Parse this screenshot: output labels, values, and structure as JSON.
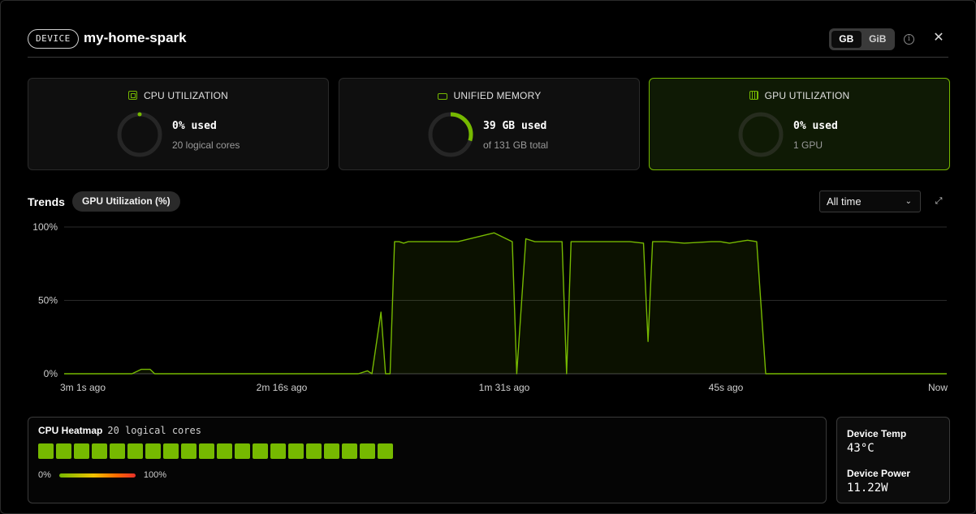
{
  "header": {
    "badge": "DEVICE",
    "device_name": "my-home-spark",
    "unit_options": [
      "GB",
      "GiB"
    ],
    "unit_selected": "GB"
  },
  "cards": {
    "cpu": {
      "title": "CPU UTILIZATION",
      "main": "0% used",
      "sub": "20 logical cores",
      "fraction": 0.0
    },
    "memory": {
      "title": "UNIFIED MEMORY",
      "main": "39  GB used",
      "sub": "of 131 GB total",
      "fraction": 0.298
    },
    "gpu": {
      "title": "GPU UTILIZATION",
      "main": "0% used",
      "sub": "1 GPU",
      "fraction": 0.0
    }
  },
  "trends": {
    "label": "Trends",
    "metric_pill": "GPU Utilization (%)",
    "range": "All time"
  },
  "chart_data": {
    "type": "area",
    "y_ticks": [
      "0%",
      "50%",
      "100%"
    ],
    "ylim": [
      0,
      100
    ],
    "x_ticks": [
      "3m 1s ago",
      "2m 16s ago",
      "1m 31s ago",
      "45s ago",
      "Now"
    ],
    "xlim_seconds_ago": [
      195,
      0
    ],
    "grid": true,
    "color": "#76b900",
    "series": [
      {
        "x_seconds_ago": [
          195,
          180,
          178,
          176,
          175,
          130,
          128,
          127,
          125,
          124,
          123,
          122,
          121,
          120,
          119,
          118,
          117,
          115,
          112,
          108,
          100,
          96,
          95,
          93,
          91,
          89,
          86,
          85,
          84,
          83,
          81,
          78,
          70,
          67,
          66,
          65,
          64,
          62,
          58,
          52,
          50,
          48,
          46,
          44,
          42,
          40,
          0
        ],
        "y": [
          0,
          0,
          3,
          3,
          0,
          0,
          2,
          0,
          42,
          0,
          0,
          90,
          90,
          89,
          90,
          90,
          90,
          90,
          90,
          90,
          96,
          90,
          0,
          92,
          90,
          90,
          90,
          90,
          0,
          90,
          90,
          90,
          90,
          89,
          22,
          90,
          90,
          90,
          89,
          90,
          90,
          89,
          90,
          91,
          90,
          0,
          0
        ]
      }
    ]
  },
  "heatmap": {
    "title": "CPU Heatmap",
    "subtitle": "20 logical cores",
    "core_levels": [
      0,
      0,
      0,
      0,
      0,
      0,
      0,
      0,
      0,
      0,
      0,
      0,
      0,
      0,
      0,
      0,
      0,
      0,
      0,
      0
    ],
    "legend_min": "0%",
    "legend_max": "100%"
  },
  "stats": {
    "temp_label": "Device Temp",
    "temp_value": "43°C",
    "power_label": "Device Power",
    "power_value": "11.22W"
  },
  "colors": {
    "accent": "#76b900",
    "track": "#262626"
  }
}
